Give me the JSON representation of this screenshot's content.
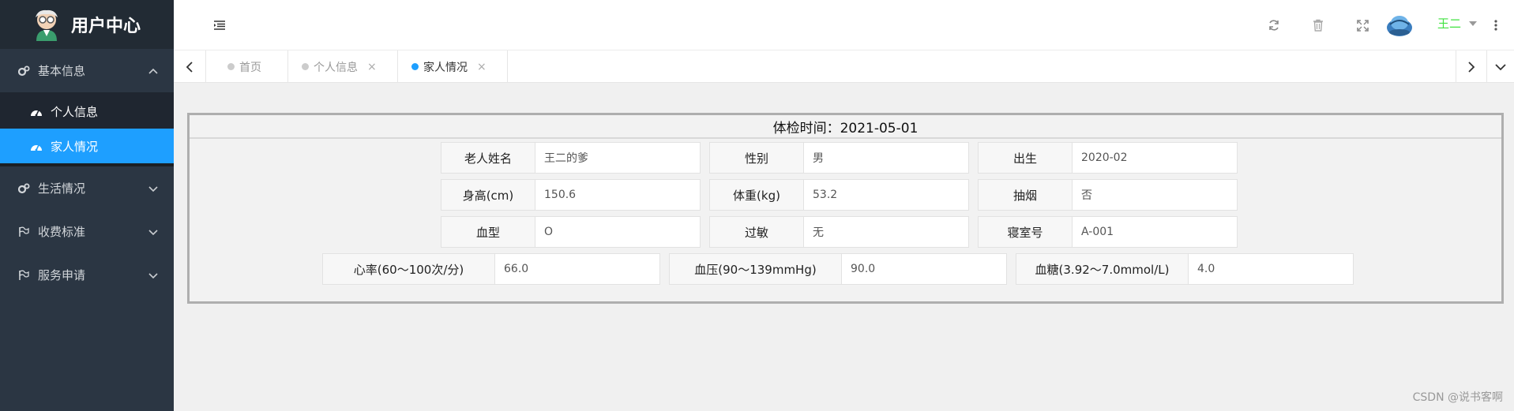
{
  "sidebar": {
    "title": "用户中心",
    "menus": [
      {
        "label": "基本信息",
        "icon": "gears-icon",
        "expanded": true,
        "children": [
          {
            "label": "个人信息",
            "icon": "dashboard-icon",
            "active": false
          },
          {
            "label": "家人情况",
            "icon": "dashboard-icon",
            "active": true
          }
        ]
      },
      {
        "label": "生活情况",
        "icon": "gears-icon",
        "expanded": false
      },
      {
        "label": "收费标准",
        "icon": "flag-icon",
        "expanded": false
      },
      {
        "label": "服务申请",
        "icon": "flag-icon",
        "expanded": false
      }
    ]
  },
  "header": {
    "user_name": "王二",
    "icons": [
      "menu-toggle-icon",
      "refresh-icon",
      "trash-icon",
      "fullscreen-icon",
      "avatar",
      "more-icon"
    ]
  },
  "tabs": [
    {
      "label": "首页",
      "closable": false,
      "active": false
    },
    {
      "label": "个人信息",
      "closable": true,
      "active": false
    },
    {
      "label": "家人情况",
      "closable": true,
      "active": true
    }
  ],
  "exam": {
    "title": "体检时间：2021-05-01",
    "rows": [
      [
        {
          "label": "老人姓名",
          "value": "王二的爹"
        },
        {
          "label": "性别",
          "value": "男"
        },
        {
          "label": "出生",
          "value": "2020-02"
        }
      ],
      [
        {
          "label": "身高(cm)",
          "value": "150.6"
        },
        {
          "label": "体重(kg)",
          "value": "53.2"
        },
        {
          "label": "抽烟",
          "value": "否"
        }
      ],
      [
        {
          "label": "血型",
          "value": "O"
        },
        {
          "label": "过敏",
          "value": "无"
        },
        {
          "label": "寝室号",
          "value": "A-001"
        }
      ],
      [
        {
          "label": "心率(60～100次/分)",
          "value": "66.0"
        },
        {
          "label": "血压(90～139mmHg)",
          "value": "90.0"
        },
        {
          "label": "血糖(3.92～7.0mmol/L)",
          "value": "4.0"
        }
      ]
    ]
  },
  "watermark": "CSDN @说书客啊",
  "colors": {
    "accent": "#1e9fff",
    "sidebar_bg": "#2b3643",
    "user_name": "#41e241"
  }
}
